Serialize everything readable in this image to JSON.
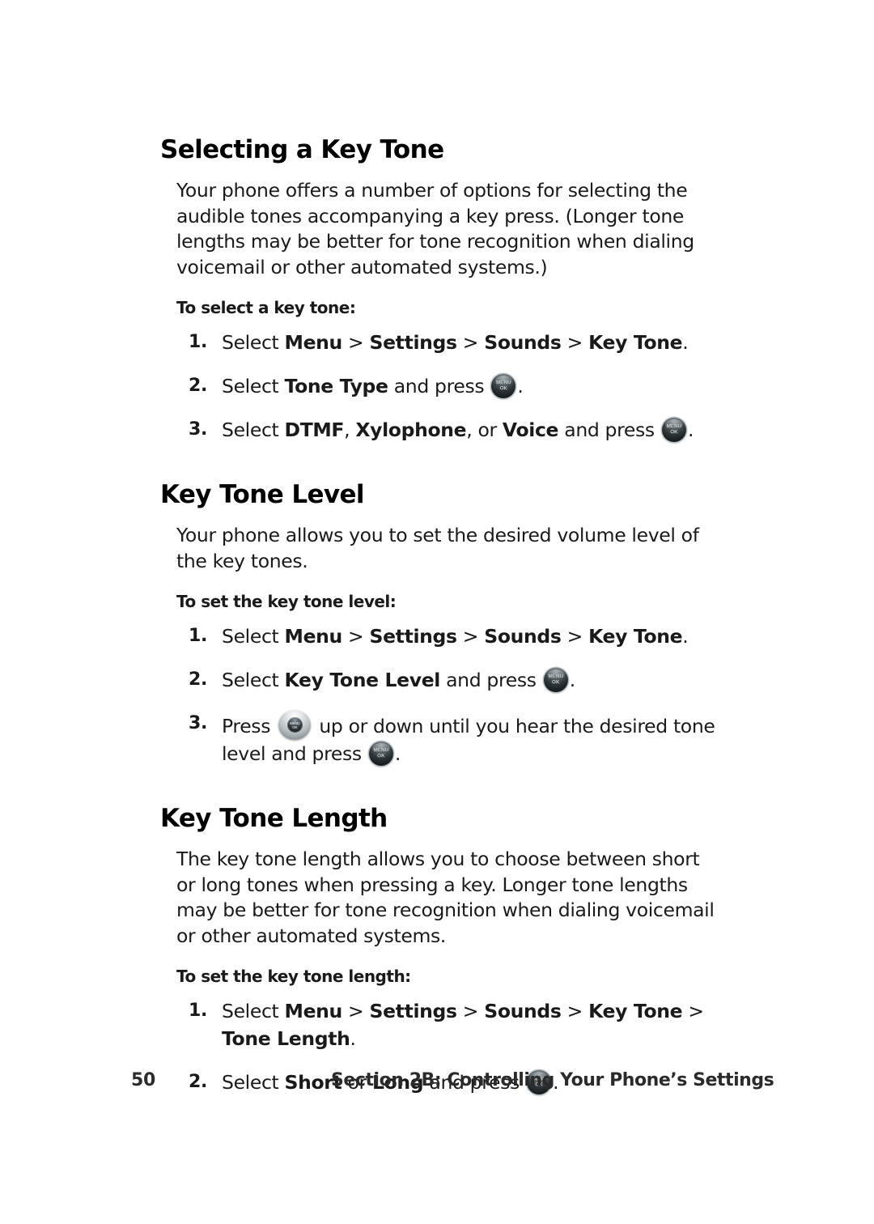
{
  "page": {
    "number": "50",
    "footer_title": "Section 2B: Controlling Your Phone’s Settings",
    "background_color": "#ffffff",
    "text_color": "#1a1a1a"
  },
  "icons": {
    "menu_ok": {
      "line1": "MENU",
      "line2": "OK",
      "name": "menu-ok-key-icon"
    },
    "nav_ring": {
      "line1": "MENU",
      "line2": "OK",
      "name": "navigation-key-icon"
    }
  },
  "sections": [
    {
      "heading": "Selecting a Key Tone",
      "body": "Your phone offers a number of options for selecting the audible tones accompanying a key press. (Longer tone lengths may be better for tone recognition when dialing voicemail or other automated systems.)",
      "lead_in": "To select a key tone:",
      "steps": [
        {
          "number": "1.",
          "parts": [
            {
              "text": "Select ",
              "bold": false
            },
            {
              "text": "Menu",
              "bold": true
            },
            {
              "text": " > ",
              "bold": false
            },
            {
              "text": "Settings",
              "bold": true
            },
            {
              "text": " > ",
              "bold": false
            },
            {
              "text": "Sounds",
              "bold": true
            },
            {
              "text": " > ",
              "bold": false
            },
            {
              "text": "Key Tone",
              "bold": true
            },
            {
              "text": ".",
              "bold": false
            }
          ]
        },
        {
          "number": "2.",
          "parts": [
            {
              "text": "Select ",
              "bold": false
            },
            {
              "text": "Tone Type",
              "bold": true
            },
            {
              "text": " and press ",
              "bold": false
            },
            {
              "icon": "menu_ok"
            },
            {
              "text": ".",
              "bold": false
            }
          ]
        },
        {
          "number": "3.",
          "parts": [
            {
              "text": "Select ",
              "bold": false
            },
            {
              "text": "DTMF",
              "bold": true
            },
            {
              "text": ", ",
              "bold": false
            },
            {
              "text": "Xylophone",
              "bold": true
            },
            {
              "text": ", or ",
              "bold": false
            },
            {
              "text": "Voice",
              "bold": true
            },
            {
              "text": " and press ",
              "bold": false
            },
            {
              "icon": "menu_ok"
            },
            {
              "text": ".",
              "bold": false
            }
          ]
        }
      ]
    },
    {
      "heading": "Key Tone Level",
      "body": "Your phone allows you to set the desired volume level of the key tones.",
      "lead_in": "To set the key tone level:",
      "steps": [
        {
          "number": "1.",
          "parts": [
            {
              "text": "Select ",
              "bold": false
            },
            {
              "text": "Menu",
              "bold": true
            },
            {
              "text": " > ",
              "bold": false
            },
            {
              "text": "Settings",
              "bold": true
            },
            {
              "text": " > ",
              "bold": false
            },
            {
              "text": "Sounds",
              "bold": true
            },
            {
              "text": " > ",
              "bold": false
            },
            {
              "text": "Key Tone",
              "bold": true
            },
            {
              "text": ".",
              "bold": false
            }
          ]
        },
        {
          "number": "2.",
          "parts": [
            {
              "text": "Select ",
              "bold": false
            },
            {
              "text": "Key Tone Level",
              "bold": true
            },
            {
              "text": " and press ",
              "bold": false
            },
            {
              "icon": "menu_ok"
            },
            {
              "text": ".",
              "bold": false
            }
          ]
        },
        {
          "number": "3.",
          "parts": [
            {
              "text": "Press ",
              "bold": false
            },
            {
              "icon": "nav_ring"
            },
            {
              "text": " up or down until you hear the desired tone level and press ",
              "bold": false
            },
            {
              "icon": "menu_ok"
            },
            {
              "text": ".",
              "bold": false
            }
          ]
        }
      ]
    },
    {
      "heading": "Key Tone Length",
      "body": "The key tone length allows you to choose between short or long tones when pressing a key. Longer tone lengths may be better for tone recognition when dialing voicemail or other automated systems.",
      "lead_in": "To set the key tone length:",
      "steps": [
        {
          "number": "1.",
          "parts": [
            {
              "text": "Select ",
              "bold": false
            },
            {
              "text": "Menu",
              "bold": true
            },
            {
              "text": " > ",
              "bold": false
            },
            {
              "text": "Settings",
              "bold": true
            },
            {
              "text": " > ",
              "bold": false
            },
            {
              "text": "Sounds",
              "bold": true
            },
            {
              "text": " > ",
              "bold": false
            },
            {
              "text": "Key Tone",
              "bold": true
            },
            {
              "text": " > ",
              "bold": false
            },
            {
              "text": "Tone Length",
              "bold": true
            },
            {
              "text": ".",
              "bold": false
            }
          ]
        },
        {
          "number": "2.",
          "parts": [
            {
              "text": "Select ",
              "bold": false
            },
            {
              "text": "Short",
              "bold": true
            },
            {
              "text": " or ",
              "bold": false
            },
            {
              "text": "Long",
              "bold": true
            },
            {
              "text": " and press ",
              "bold": false
            },
            {
              "icon": "menu_ok"
            },
            {
              "text": ".",
              "bold": false
            }
          ]
        }
      ]
    }
  ]
}
